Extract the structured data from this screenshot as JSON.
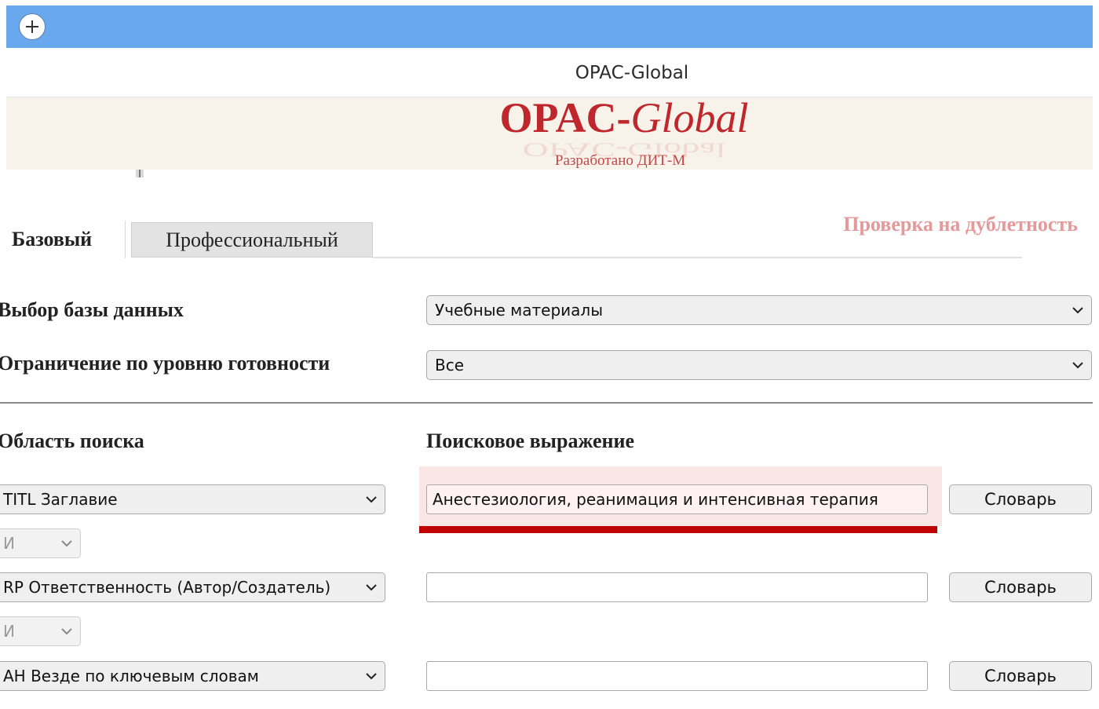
{
  "window": {
    "title": "OPAC-Global",
    "add_icon": "plus-circle-icon"
  },
  "banner": {
    "logo_opac": "OPAC-",
    "logo_global": "Global",
    "developed_by": "Разработано ДИТ-М",
    "logo_color": "#c0272d"
  },
  "tabs": [
    {
      "label": "Базовый",
      "active": true
    },
    {
      "label": "Профессиональный",
      "active": false
    }
  ],
  "duplicate_check_link": "Проверка на дублетность",
  "database": {
    "label": "Выбор базы данных",
    "selected": "Учебные материалы"
  },
  "readiness": {
    "label": "Ограничение по уровню готовности",
    "selected": "Все"
  },
  "search": {
    "area_header": "Область поиска",
    "expression_header": "Поисковое выражение",
    "rows": [
      {
        "field": "TITL Заглавие",
        "value": "Анестезиология, реанимация и интенсивная терапия",
        "dict_label": "Словарь"
      },
      {
        "field": "RP Ответственность (Автор/Создатель)",
        "value": "",
        "dict_label": "Словарь"
      },
      {
        "field": "AH Везде по ключевым словам",
        "value": "",
        "dict_label": "Словарь"
      }
    ],
    "operators": [
      "И",
      "И"
    ]
  },
  "colors": {
    "topbar": "#6aa8ee",
    "highlight": "#fbe6e6",
    "underline": "#c00000",
    "duplicate_link": "#e49a9a"
  }
}
